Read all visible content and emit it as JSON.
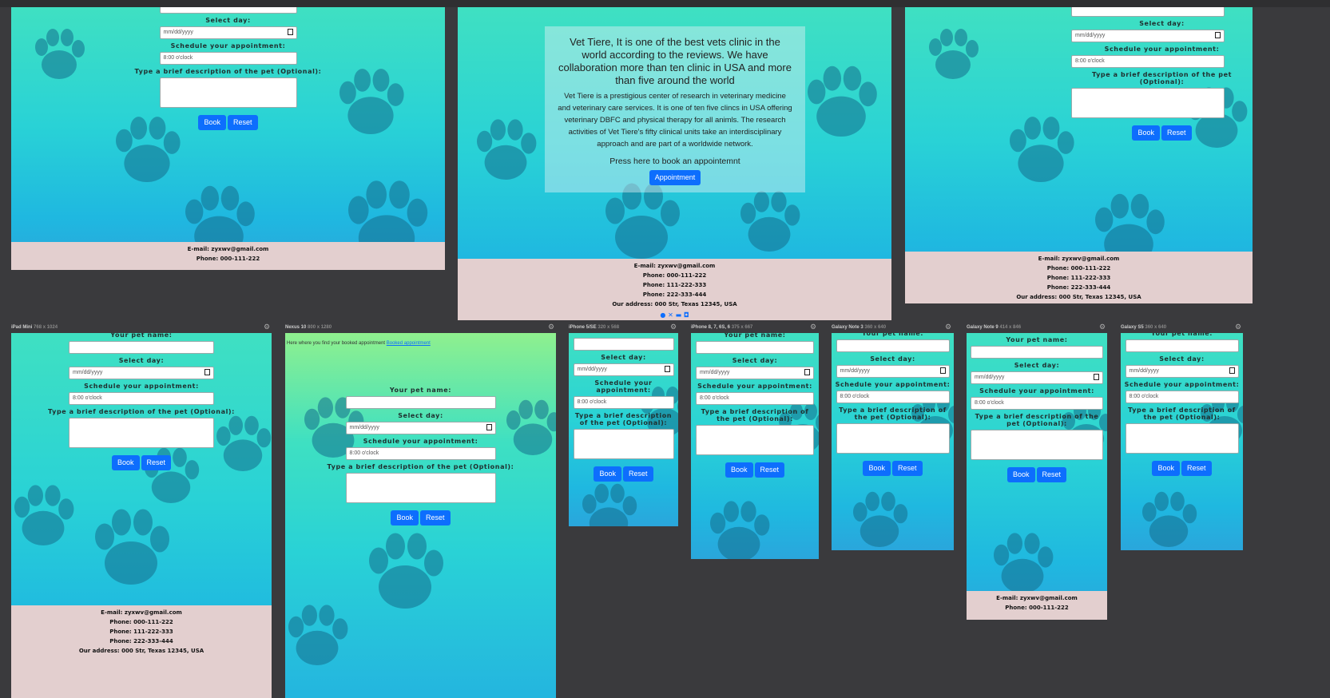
{
  "form": {
    "pet_name_label": "Your pet name:",
    "day_label": "Select day:",
    "date_placeholder": "mm/dd/yyyy",
    "schedule_label": "Schedule your appointment:",
    "time_value": "8:00 o'clock",
    "desc_label": "Type a brief description of the pet (Optional):",
    "book": "Book",
    "reset": "Reset"
  },
  "footer": {
    "email": "E-mail: zyxwv@gmail.com",
    "phone1": "Phone: 000-111-222",
    "phone2": "Phone: 111-222-333",
    "phone3": "Phone: 222-333-444",
    "address": "Our address: 000 Str, Texas 12345, USA"
  },
  "hero": {
    "heading": "Vet Tiere, It is one of the best vets clinic in the world according to the reviews. We have collaboration more than ten clinic in USA and more than five around the world",
    "body": "Vet Tiere is a prestigious center of research in veterinary medicine and veterinary care services. It is one of ten five clincs in USA offering veterinary DBFC and physical therapy for all animls. The research activities of Vet Tiere's fifty clinical units take an interdisciplinary approach and are part of a worldwide network.",
    "press": "Press here to book an appointemnt",
    "button": "Appointment"
  },
  "booked": {
    "text": "Here where you find your booked appointment",
    "link": "Booked appointment"
  },
  "devices": {
    "ipad_mini": "iPad Mini",
    "ipad_mini_size": "768 x 1024",
    "nexus10": "Nexus 10",
    "nexus10_size": "800 x 1280",
    "iphone5": "iPhone 5/SE",
    "iphone5_size": "320 x 568",
    "iphone8": "iPhone 8, 7, 6S, 6",
    "iphone8_size": "375 x 667",
    "note3": "Galaxy Note 3",
    "note3_size": "360 x 640",
    "note9": "Galaxy Note 9",
    "note9_size": "414 x 846",
    "s5": "Galaxy S5",
    "s5_size": "360 x 640"
  },
  "colors": {
    "button": "#0d6efd",
    "footer": "#e3cfcf",
    "bg": "#3a3a3d"
  }
}
